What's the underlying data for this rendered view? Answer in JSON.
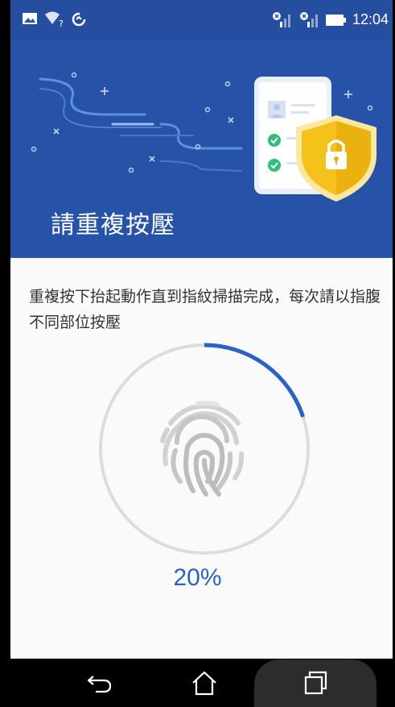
{
  "status_bar": {
    "time": "12:04",
    "icons": [
      "image-icon",
      "wifi-question-icon",
      "data-saver-icon",
      "signal-no-sim-icon",
      "signal-no-sim-icon",
      "battery-icon"
    ]
  },
  "header": {
    "title": "請重複按壓"
  },
  "instructions": {
    "text": "重複按下抬起動作直到指紋掃描完成，每次請以指腹不同部位按壓"
  },
  "progress": {
    "label": "20%",
    "value": 0.2
  },
  "nav": {
    "back": "back-icon",
    "home": "home-icon",
    "recents": "recents-icon"
  },
  "colors": {
    "header_bg": "#2653a8",
    "accent": "#2a62c8",
    "ring_track": "#dcdcdc",
    "shield": "#f4c21b"
  }
}
